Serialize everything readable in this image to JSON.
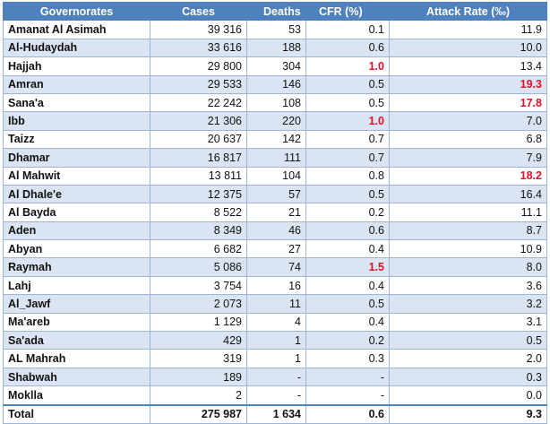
{
  "headers": [
    "Governorates",
    "Cases",
    "Deaths",
    "CFR (%)",
    "Attack Rate (‰)"
  ],
  "rows": [
    {
      "gov": "Amanat Al Asimah",
      "cases": "39 316",
      "deaths": "53",
      "cfr": "0.1",
      "ar": "11.9"
    },
    {
      "gov": "Al-Hudaydah",
      "cases": "33 616",
      "deaths": "188",
      "cfr": "0.6",
      "ar": "10.0"
    },
    {
      "gov": "Hajjah",
      "cases": "29 800",
      "deaths": "304",
      "cfr": "1.0",
      "ar": "13.4"
    },
    {
      "gov": "Amran",
      "cases": "29 533",
      "deaths": "146",
      "cfr": "0.5",
      "ar": "19.3"
    },
    {
      "gov": "Sana'a",
      "cases": "22 242",
      "deaths": "108",
      "cfr": "0.5",
      "ar": "17.8"
    },
    {
      "gov": "Ibb",
      "cases": "21 306",
      "deaths": "220",
      "cfr": "1.0",
      "ar": "7.0"
    },
    {
      "gov": "Taizz",
      "cases": "20 637",
      "deaths": "142",
      "cfr": "0.7",
      "ar": "6.8"
    },
    {
      "gov": "Dhamar",
      "cases": "16 817",
      "deaths": "111",
      "cfr": "0.7",
      "ar": "7.9"
    },
    {
      "gov": "Al Mahwit",
      "cases": "13 811",
      "deaths": "104",
      "cfr": "0.8",
      "ar": "18.2"
    },
    {
      "gov": "Al Dhale'e",
      "cases": "12 375",
      "deaths": "57",
      "cfr": "0.5",
      "ar": "16.4"
    },
    {
      "gov": "Al Bayda",
      "cases": "8 522",
      "deaths": "21",
      "cfr": "0.2",
      "ar": "11.1"
    },
    {
      "gov": "Aden",
      "cases": "8 349",
      "deaths": "46",
      "cfr": "0.6",
      "ar": "8.7"
    },
    {
      "gov": "Abyan",
      "cases": "6 682",
      "deaths": "27",
      "cfr": "0.4",
      "ar": "10.9"
    },
    {
      "gov": "Raymah",
      "cases": "5 086",
      "deaths": "74",
      "cfr": "1.5",
      "ar": "8.0"
    },
    {
      "gov": "Lahj",
      "cases": "3 754",
      "deaths": "16",
      "cfr": "0.4",
      "ar": "3.6"
    },
    {
      "gov": "Al_Jawf",
      "cases": "2 073",
      "deaths": "11",
      "cfr": "0.5",
      "ar": "3.2"
    },
    {
      "gov": "Ma'areb",
      "cases": "1 129",
      "deaths": "4",
      "cfr": "0.4",
      "ar": "3.1"
    },
    {
      "gov": "Sa'ada",
      "cases": "429",
      "deaths": "1",
      "cfr": "0.2",
      "ar": "0.5"
    },
    {
      "gov": "AL Mahrah",
      "cases": "319",
      "deaths": "1",
      "cfr": "0.3",
      "ar": "2.0"
    },
    {
      "gov": "Shabwah",
      "cases": "189",
      "deaths": "-",
      "cfr": "-",
      "ar": "0.3"
    },
    {
      "gov": "Moklla",
      "cases": "2",
      "deaths": "-",
      "cfr": "-",
      "ar": "0.0"
    }
  ],
  "total": {
    "gov": "Total",
    "cases": "275 987",
    "deaths": "1 634",
    "cfr": "0.6",
    "ar": "9.3"
  },
  "highlight": {
    "color": "#e0102a",
    "cfr_rows": [
      "Hajjah",
      "Ibb",
      "Raymah"
    ],
    "ar_rows": [
      "Amran",
      "Sana'a",
      "Al Mahwit"
    ]
  },
  "colors": {
    "header_bg": "#4f81bd",
    "stripe_bg": "#dbe4f2",
    "border": "#9fb5d8"
  }
}
